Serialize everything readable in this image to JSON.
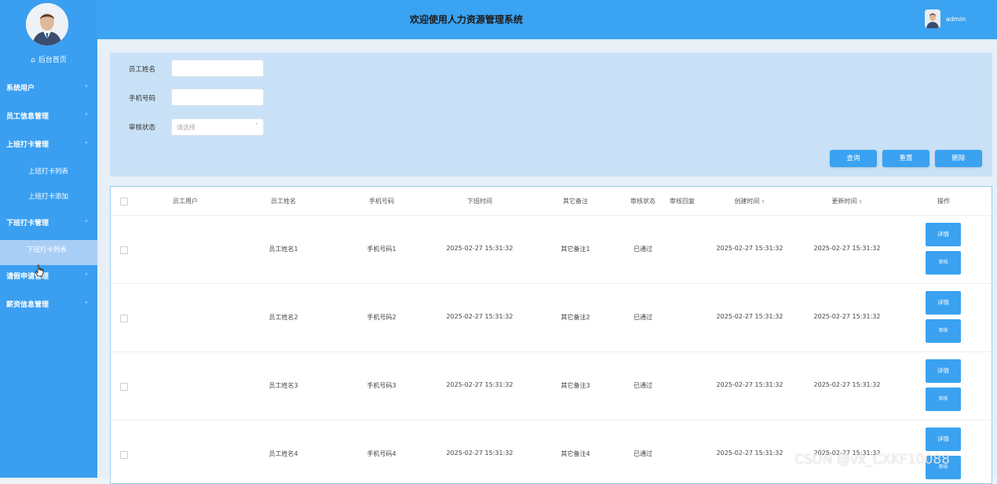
{
  "header": {
    "title": "欢迎使用人力资源管理系统",
    "username": "admin"
  },
  "sidebar": {
    "home_label": "后台首页",
    "menus": [
      {
        "label": "系统用户",
        "chevron": "˅"
      },
      {
        "label": "员工信息管理",
        "chevron": "˅"
      },
      {
        "label": "上班打卡管理",
        "chevron": "˄"
      },
      {
        "label": "上班打卡列表"
      },
      {
        "label": "上班打卡添加"
      },
      {
        "label": "下班打卡管理",
        "chevron": "˄"
      },
      {
        "label": "下班打卡列表"
      },
      {
        "label": "请假申请管理",
        "chevron": "˅"
      },
      {
        "label": "薪资信息管理",
        "chevron": "˅"
      }
    ]
  },
  "search": {
    "name_label": "员工姓名",
    "phone_label": "手机号码",
    "status_label": "审核状态",
    "status_placeholder": "请选择",
    "query_button": "查询",
    "reset_button": "重置",
    "delete_button": "删除"
  },
  "table": {
    "columns": [
      "员工用户",
      "员工姓名",
      "手机号码",
      "下班时间",
      "其它备注",
      "审核状态",
      "审核回复",
      "创建时间",
      "更新时间",
      "操作"
    ],
    "detail_label": "详情",
    "audit_label": "审核",
    "rows": [
      {
        "user": "",
        "name": "员工姓名1",
        "phone": "手机号码1",
        "off_time": "2025-02-27 15:31:32",
        "remark": "其它备注1",
        "status": "已通过",
        "reply": "",
        "created": "2025-02-27 15:31:32",
        "updated": "2025-02-27 15:31:32"
      },
      {
        "user": "",
        "name": "员工姓名2",
        "phone": "手机号码2",
        "off_time": "2025-02-27 15:31:32",
        "remark": "其它备注2",
        "status": "已通过",
        "reply": "",
        "created": "2025-02-27 15:31:32",
        "updated": "2025-02-27 15:31:32"
      },
      {
        "user": "",
        "name": "员工姓名3",
        "phone": "手机号码3",
        "off_time": "2025-02-27 15:31:32",
        "remark": "其它备注3",
        "status": "已通过",
        "reply": "",
        "created": "2025-02-27 15:31:32",
        "updated": "2025-02-27 15:31:32"
      },
      {
        "user": "",
        "name": "员工姓名4",
        "phone": "手机号码4",
        "off_time": "2025-02-27 15:31:32",
        "remark": "其它备注4",
        "status": "已通过",
        "reply": "",
        "created": "2025-02-27 15:31:32",
        "updated": "2025-02-27 15:31:32"
      }
    ]
  },
  "watermark": "CSDN @vx_CXKF10088",
  "colors": {
    "primary": "#3aa2f1",
    "sidebar": "#3a9ff0",
    "active_item": "#a9cef6",
    "search_panel": "#c9e1f6"
  }
}
